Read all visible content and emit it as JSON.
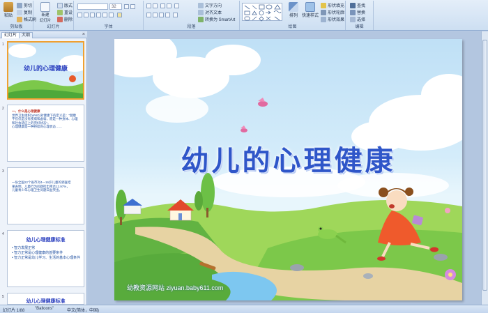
{
  "ribbon": {
    "clipboard": {
      "paste": "粘贴",
      "cut": "剪切",
      "copy": "复制",
      "format_painter": "格式刷",
      "group": "剪贴板"
    },
    "slides": {
      "new_slide": "新建\n幻灯片",
      "layout": "版式",
      "reset": "重设",
      "delete": "删除",
      "group": "幻灯片"
    },
    "font": {
      "font_size": "32",
      "group": "字体"
    },
    "paragraph": {
      "text_direction": "文字方向",
      "align_text": "对齐文本",
      "smartart": "转换为 SmartArt",
      "group": "段落"
    },
    "drawing": {
      "arrange": "排列",
      "quick_styles": "快速样式",
      "shape_fill": "形状填充",
      "shape_outline": "形状轮廓",
      "shape_effects": "形状效果",
      "group": "绘图"
    },
    "editing": {
      "find": "查找",
      "replace": "替换",
      "select": "选择",
      "group": "编辑"
    }
  },
  "left_pane": {
    "tab_slides": "幻灯片",
    "tab_outline": "大纲",
    "close": "×",
    "thumbnails": [
      {
        "num": "1",
        "title": "幼儿的心理健康"
      },
      {
        "num": "2",
        "lines": [
          "一、什么是心理健康",
          "世界卫生组织(WHO)对健康下的定义是：“健康",
          "不仅仅是没有疾病和虚弱，而是一种身体、心理",
          "和社会适应上的完好状态”。",
          "心理健康是一种持续的心理状态……"
        ]
      },
      {
        "num": "3",
        "lines": [
          "一份全国22个省市对4—16岁儿童的调查结",
          "果表明，儿童行为问题检出率达12.97%，",
          "儿童青少年心理卫生问题日益突出。"
        ]
      },
      {
        "num": "4",
        "title": "幼儿心理健康标准",
        "lines": [
          "• 智力发展正常",
          "• 智力正常是心理健康的首要条件",
          "• 智力正常是幼儿学习、生活的基本心理条件"
        ]
      },
      {
        "num": "5",
        "title": "幼儿心理健康标准"
      }
    ]
  },
  "slide": {
    "title": "幼儿的心理健康",
    "watermark": "幼教资源网站 ziyuan.baby611.com"
  },
  "status": {
    "slide_index": "幻灯片 1/88",
    "theme": "\"Balloons\"",
    "language": "中文(简体，中国)"
  }
}
